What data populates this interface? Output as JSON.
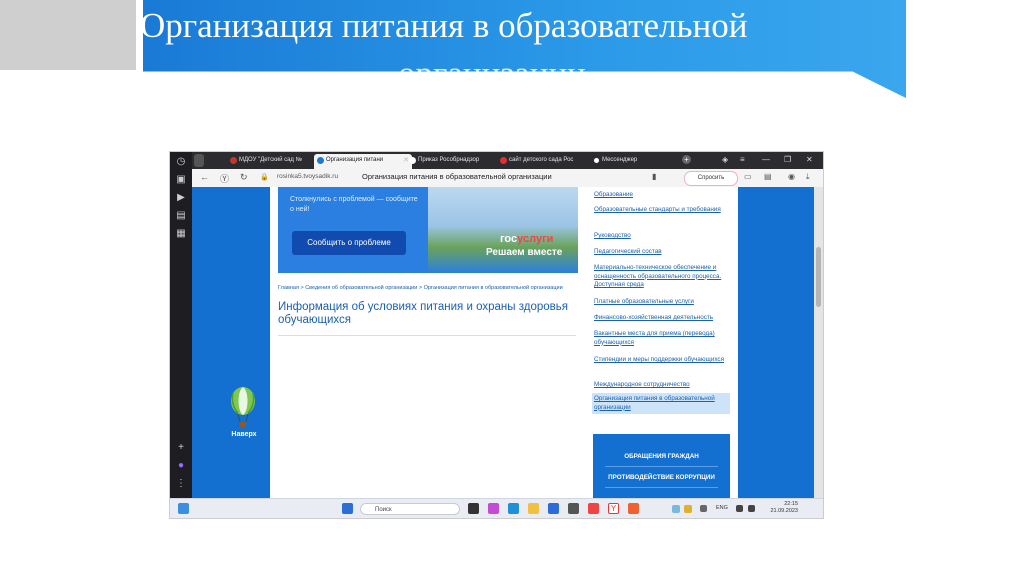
{
  "slide": {
    "title_line1": "Организация питания в образовательной",
    "title_line2": "организации"
  },
  "browser": {
    "tabs": [
      {
        "label": "МДОУ \"Детский сад №",
        "active": false
      },
      {
        "label": "Организация питани",
        "active": true
      },
      {
        "label": "Приказ Рособрнадзор",
        "active": false
      },
      {
        "label": "сайт детского сада Рос",
        "active": false
      },
      {
        "label": "Мессенджер",
        "active": false
      }
    ],
    "url": "rosinka5.tvoysadik.ru",
    "page_title": "Организация питания в образовательной организации",
    "ask_button": "Спросить"
  },
  "page": {
    "banner": {
      "text": "Столкнулись с проблемой — сообщите о ней!",
      "button": "Сообщить о проблеме",
      "logo_a": "гос",
      "logo_b": "услуги",
      "tagline": "Решаем вместе"
    },
    "breadcrumb": "Главная > Сведения об образовательной организации > Организация питания в образовательной организации",
    "heading": "Информация об условиях питания и охраны здоровья обучающихся",
    "up_label": "Наверх",
    "side_nav": [
      "Образование",
      "Образовательные стандарты и требования",
      "Руководство",
      "Педагогический состав",
      "Материально-техническое обеспечение и оснащенность образовательного процесса. Доступная среда",
      "Платные образовательные услуги",
      "Финансово-хозяйственная деятельность",
      "Вакантные места для приема (перевода) обучающихся",
      "Стипендии и меры поддержки обучающихся",
      "Международное сотрудничество",
      "Организация питания в образовательной организации"
    ],
    "side_box": [
      "ОБРАЩЕНИЯ ГРАЖДАН",
      "ПРОТИВОДЕЙСТВИЕ КОРРУПЦИИ"
    ]
  },
  "taskbar": {
    "search_placeholder": "Поиск",
    "lang": "ENG",
    "time": "22:15",
    "date": "21.09.2023"
  },
  "colors": {
    "slide_blue": "#1a7ad6",
    "site_blue": "#1470d0",
    "link_blue": "#1a5fb4"
  }
}
